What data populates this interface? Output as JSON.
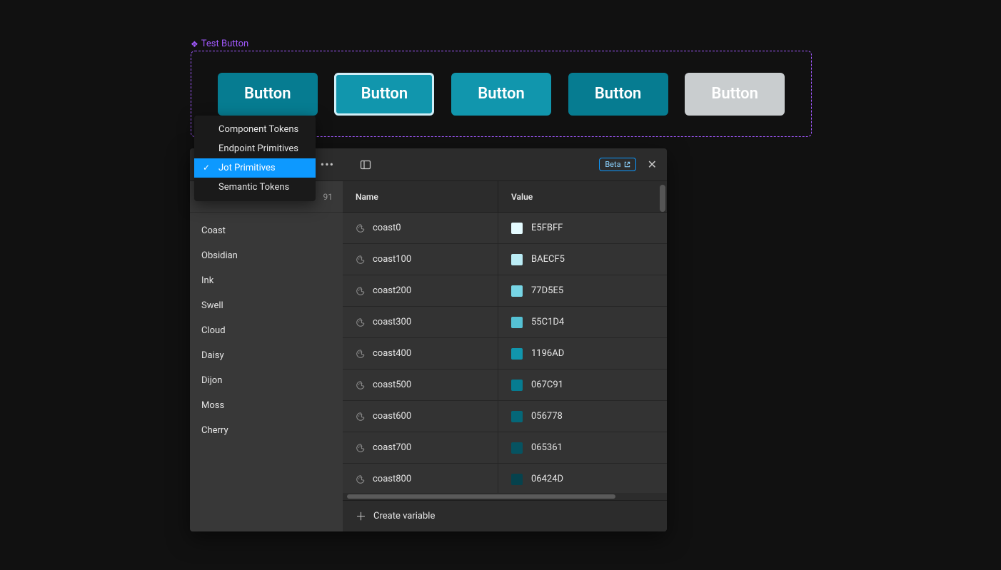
{
  "component": {
    "label": "Test Button",
    "buttons": [
      "Button",
      "Button",
      "Button",
      "Button",
      "Button"
    ]
  },
  "dropdown": {
    "items": [
      {
        "label": "Component Tokens",
        "selected": false
      },
      {
        "label": "Endpoint Primitives",
        "selected": false
      },
      {
        "label": "Jot Primitives",
        "selected": true
      },
      {
        "label": "Semantic Tokens",
        "selected": false
      }
    ]
  },
  "panel": {
    "allvars_count": "91",
    "beta": "Beta",
    "create_label": "Create variable",
    "headers": {
      "name": "Name",
      "value": "Value"
    }
  },
  "sidebar": {
    "groups": [
      "Coast",
      "Obsidian",
      "Ink",
      "Swell",
      "Cloud",
      "Daisy",
      "Dijon",
      "Moss",
      "Cherry"
    ]
  },
  "variables": [
    {
      "name": "coast0",
      "hex": "E5FBFF"
    },
    {
      "name": "coast100",
      "hex": "BAECF5"
    },
    {
      "name": "coast200",
      "hex": "77D5E5"
    },
    {
      "name": "coast300",
      "hex": "55C1D4"
    },
    {
      "name": "coast400",
      "hex": "1196AD"
    },
    {
      "name": "coast500",
      "hex": "067C91"
    },
    {
      "name": "coast600",
      "hex": "056778"
    },
    {
      "name": "coast700",
      "hex": "065361"
    },
    {
      "name": "coast800",
      "hex": "06424D"
    }
  ]
}
